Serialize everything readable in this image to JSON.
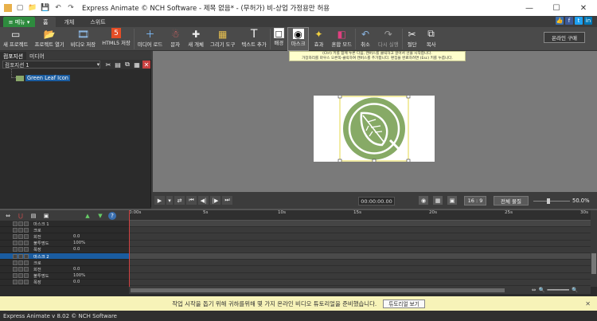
{
  "window": {
    "title": "Express Animate © NCH Software - 제목 없음* - (무허가) 비-상업 가정용만 허용",
    "minimize": "—",
    "maximize": "☐",
    "close": "✕"
  },
  "quickaccess": [
    "▢",
    "📁",
    "💾",
    "↶",
    "↷"
  ],
  "menu": {
    "label": "≡ 메뉴 ▾"
  },
  "tabs": [
    {
      "label": "홈",
      "active": true
    },
    {
      "label": "개체",
      "active": false
    },
    {
      "label": "스위트",
      "active": false
    }
  ],
  "social": {
    "like": "👍",
    "facebook": "f",
    "twitter": "t",
    "linkedin": "in"
  },
  "ribbon": {
    "buttons": [
      {
        "label": "새 프로젝트",
        "icon": "new-project-icon",
        "glyph": "▭"
      },
      {
        "label": "프로젝트 열기",
        "icon": "open-folder-icon",
        "glyph": "📂"
      },
      {
        "label": "비디오 저장",
        "icon": "save-video-icon",
        "glyph": "🎞"
      },
      {
        "label": "HTML5 저장",
        "icon": "html5-icon",
        "glyph": "5"
      },
      {
        "label": "미디어 로드",
        "icon": "load-media-icon",
        "glyph": "＋"
      },
      {
        "label": "문자",
        "icon": "character-icon",
        "glyph": "☃"
      },
      {
        "label": "새 개체",
        "icon": "new-object-icon",
        "glyph": "✚"
      },
      {
        "label": "그리기 도구",
        "icon": "draw-tools-icon",
        "glyph": "▦"
      },
      {
        "label": "텍스트 추가",
        "icon": "text-icon",
        "glyph": "T"
      },
      {
        "label": "배경",
        "icon": "background-icon",
        "glyph": "◻"
      },
      {
        "label": "마스크",
        "icon": "mask-icon",
        "glyph": "◉"
      },
      {
        "label": "효과",
        "icon": "effects-icon",
        "glyph": "✦"
      },
      {
        "label": "혼합 모드",
        "icon": "blend-mode-icon",
        "glyph": "◧"
      },
      {
        "label": "취소",
        "icon": "undo-icon",
        "glyph": "↶"
      },
      {
        "label": "다시 실행",
        "icon": "redo-icon",
        "glyph": "↷"
      },
      {
        "label": "절단",
        "icon": "cut-icon",
        "glyph": "✂"
      },
      {
        "label": "복사",
        "icon": "copy-icon",
        "glyph": "⧉"
      }
    ],
    "online_buy": "온라인 구매",
    "hint_line1": "(Ctrl) 키를 함께 누른 다음, 캔버스를 클릭하고 끌어서 선을 시작합니다.",
    "hint_line2": "가장자리를 마우스 오른쪽-클릭하여 캔버스를 추가합니다. 편집을 완료하려면 (Esc) 키를 누릅니다."
  },
  "leftpanel": {
    "tabs": [
      {
        "label": "컴포지션",
        "active": true
      },
      {
        "label": "미디어",
        "active": false
      }
    ],
    "composition_select": "컴포지션 1",
    "tree_item": "Green Leaf Icon"
  },
  "playback": {
    "timecode": "00:00:00.00",
    "ratio": "16 : 9",
    "fit_button": "전체 물질",
    "zoom": "50.0%"
  },
  "timeline": {
    "ticks": [
      "0:00s",
      "5s",
      "10s",
      "15s",
      "20s",
      "25s",
      "30s"
    ],
    "rows": [
      {
        "label": "마스크 1",
        "value": "",
        "selected": false,
        "header": true
      },
      {
        "label": "크로",
        "value": "",
        "selected": false,
        "header": false
      },
      {
        "label": "회전",
        "value": "0.0",
        "selected": false,
        "header": false
      },
      {
        "label": "불투명도",
        "value": "100%",
        "selected": false,
        "header": false
      },
      {
        "label": "폭장",
        "value": "0.0",
        "selected": false,
        "header": false
      },
      {
        "label": "마스크 2",
        "value": "",
        "selected": true,
        "header": true
      },
      {
        "label": "크로",
        "value": "",
        "selected": false,
        "header": false
      },
      {
        "label": "회전",
        "value": "0.0",
        "selected": false,
        "header": false
      },
      {
        "label": "불투명도",
        "value": "100%",
        "selected": false,
        "header": false
      },
      {
        "label": "폭장",
        "value": "0.0",
        "selected": false,
        "header": false
      }
    ]
  },
  "notice": {
    "text": "작업 시작을 돕기 위해 귀하를위해 몇 가지 온라인 비디오 튜토리얼을 준비했습니다.",
    "button": "튜토리얼 보기",
    "close": "✕"
  },
  "status": "Express Animate v 8.02 © NCH Software",
  "colors": {
    "leaf_green": "#87aa66",
    "selection_blue": "#1a5ca0",
    "menu_green": "#2e8b3e",
    "notice_yellow": "#f7f3b8"
  }
}
